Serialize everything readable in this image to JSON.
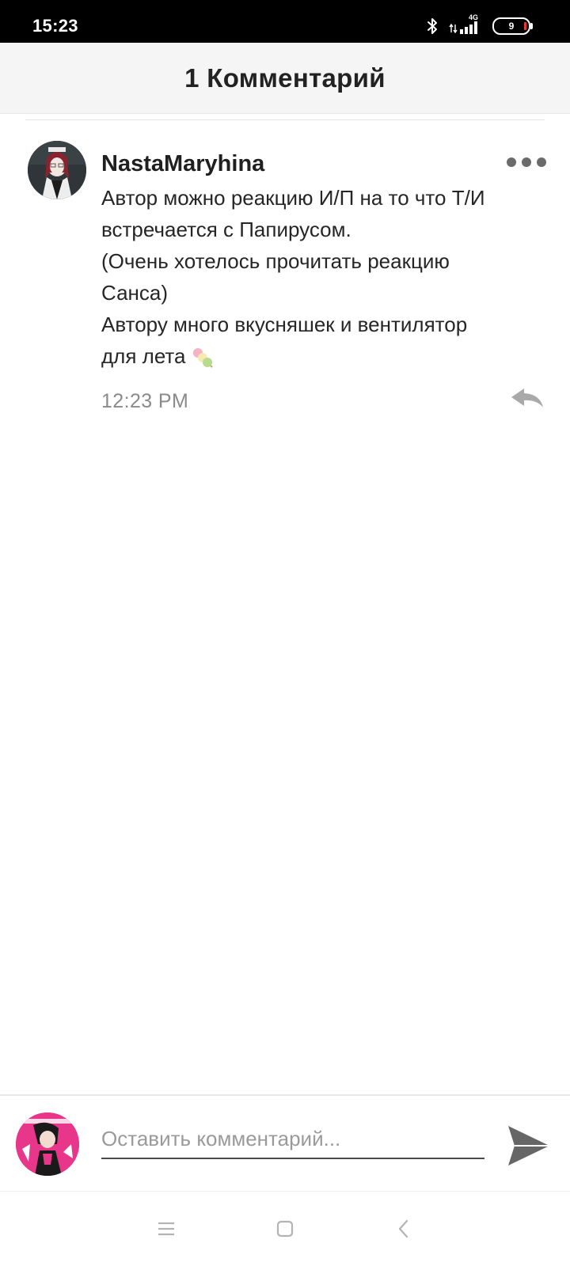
{
  "status_bar": {
    "time": "15:23",
    "network": "4G",
    "battery": "9",
    "icons": [
      "bluetooth-icon",
      "signal-icon",
      "battery-icon"
    ]
  },
  "header": {
    "title": "1 Комментарий"
  },
  "comments": [
    {
      "username": "NastaMaryhina",
      "text_lines": [
        "Автор можно реакцию И/П на то что Т/И",
        "встречается с Папирусом.",
        "(Очень хотелось прочитать реакцию",
        "Санса)",
        "Автору много вкусняшек и вентилятор",
        "для лета"
      ],
      "emoji": "dango-icon",
      "time": "12:23 PM"
    }
  ],
  "composer": {
    "placeholder": "Оставить комментарий..."
  },
  "nav": {
    "items": [
      "menu-icon",
      "home-icon",
      "back-icon"
    ]
  },
  "colors": {
    "header_bg": "#f5f5f5",
    "status_bg": "#000000",
    "timestamp": "#8a8a8a",
    "icon_gray": "#6b6b6b",
    "avatar_accent": "#e8378a"
  }
}
